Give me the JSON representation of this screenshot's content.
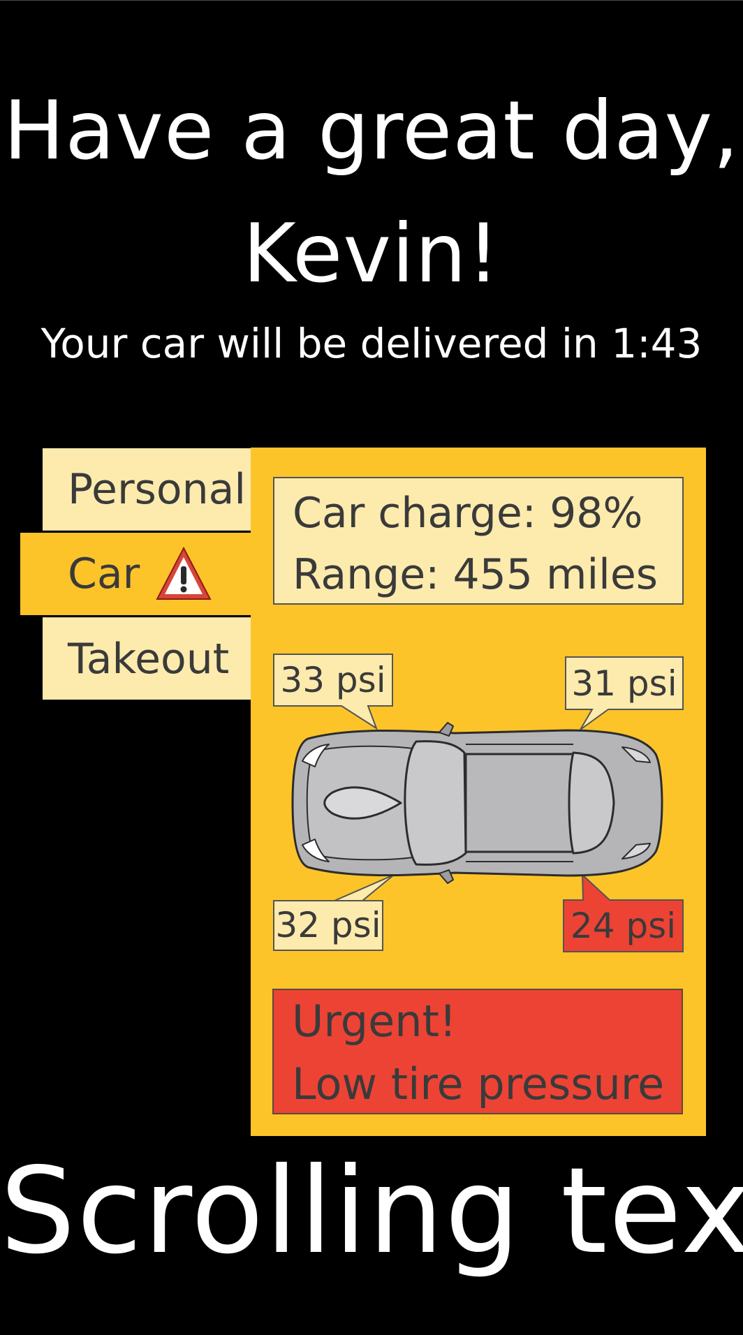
{
  "greeting": {
    "line1": "Have a great day,",
    "line2": "Kevin!"
  },
  "subtitle": "Your car will be delivered in 1:43",
  "tabs": [
    {
      "label": "Personal"
    },
    {
      "label": "Car"
    },
    {
      "label": "Takeout"
    }
  ],
  "car_info": {
    "charge": "Car charge: 98%",
    "range": "Range: 455 miles"
  },
  "tires": {
    "front_left": "33 psi",
    "front_right": "31 psi",
    "rear_left": "32 psi",
    "rear_right": "24 psi"
  },
  "alert": {
    "line1": "Urgent!",
    "line2": "Low tire pressure"
  },
  "scroll_text": "Scrolling text",
  "icons": {
    "car_tab": "warning-triangle-icon",
    "vehicle": "car-top-view-icon"
  },
  "colors": {
    "background": "#000000",
    "panel": "#fdc42a",
    "tab_inactive": "#fcebad",
    "alert": "#ec4335",
    "text_dark": "#3a3a3a",
    "text_light": "#ffffff"
  }
}
